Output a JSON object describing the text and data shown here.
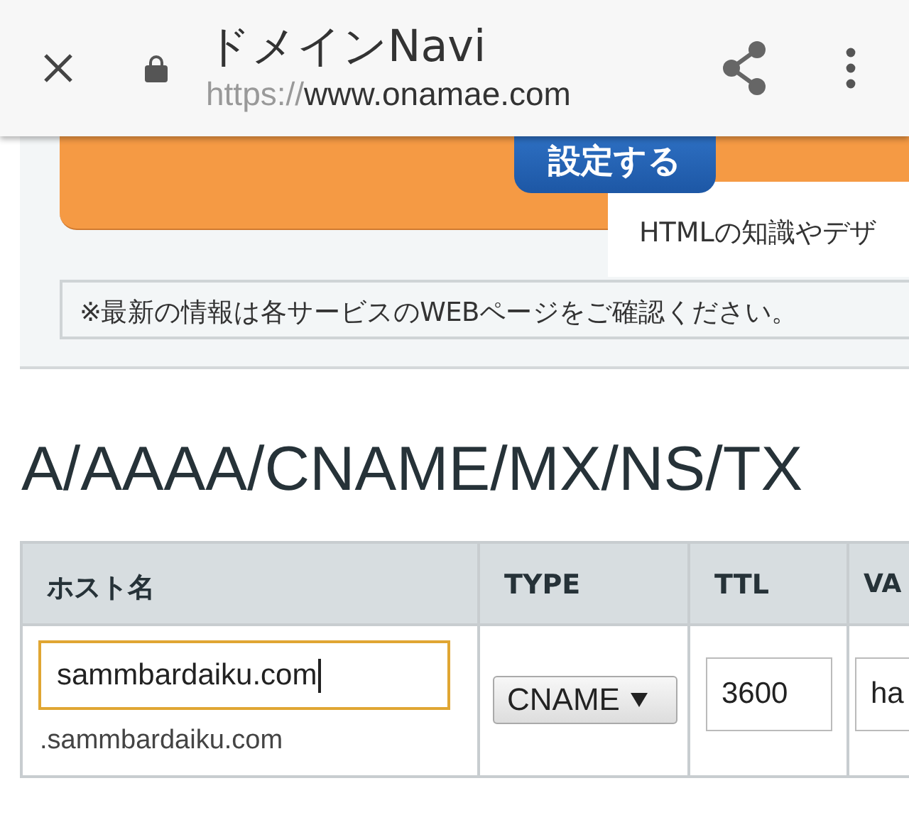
{
  "toolbar": {
    "title": "ドメインNavi",
    "url_scheme": "https://",
    "url_host": "www.onamae.com"
  },
  "banner": {
    "button": "設定する",
    "description": "HTMLの知識やデザ"
  },
  "notice": "※最新の情報は各サービスのWEBページをご確認ください。",
  "section": {
    "heading": "A/AAAA/CNAME/MX/NS/TX"
  },
  "table": {
    "columns": [
      "ホスト名",
      "TYPE",
      "TTL",
      "VA"
    ],
    "rows": [
      {
        "host_value": "sammbardaiku.com",
        "host_focused": true,
        "domain_suffix": ".sammbardaiku.com",
        "type": "CNAME",
        "ttl": "3600",
        "value": "ha"
      }
    ]
  }
}
